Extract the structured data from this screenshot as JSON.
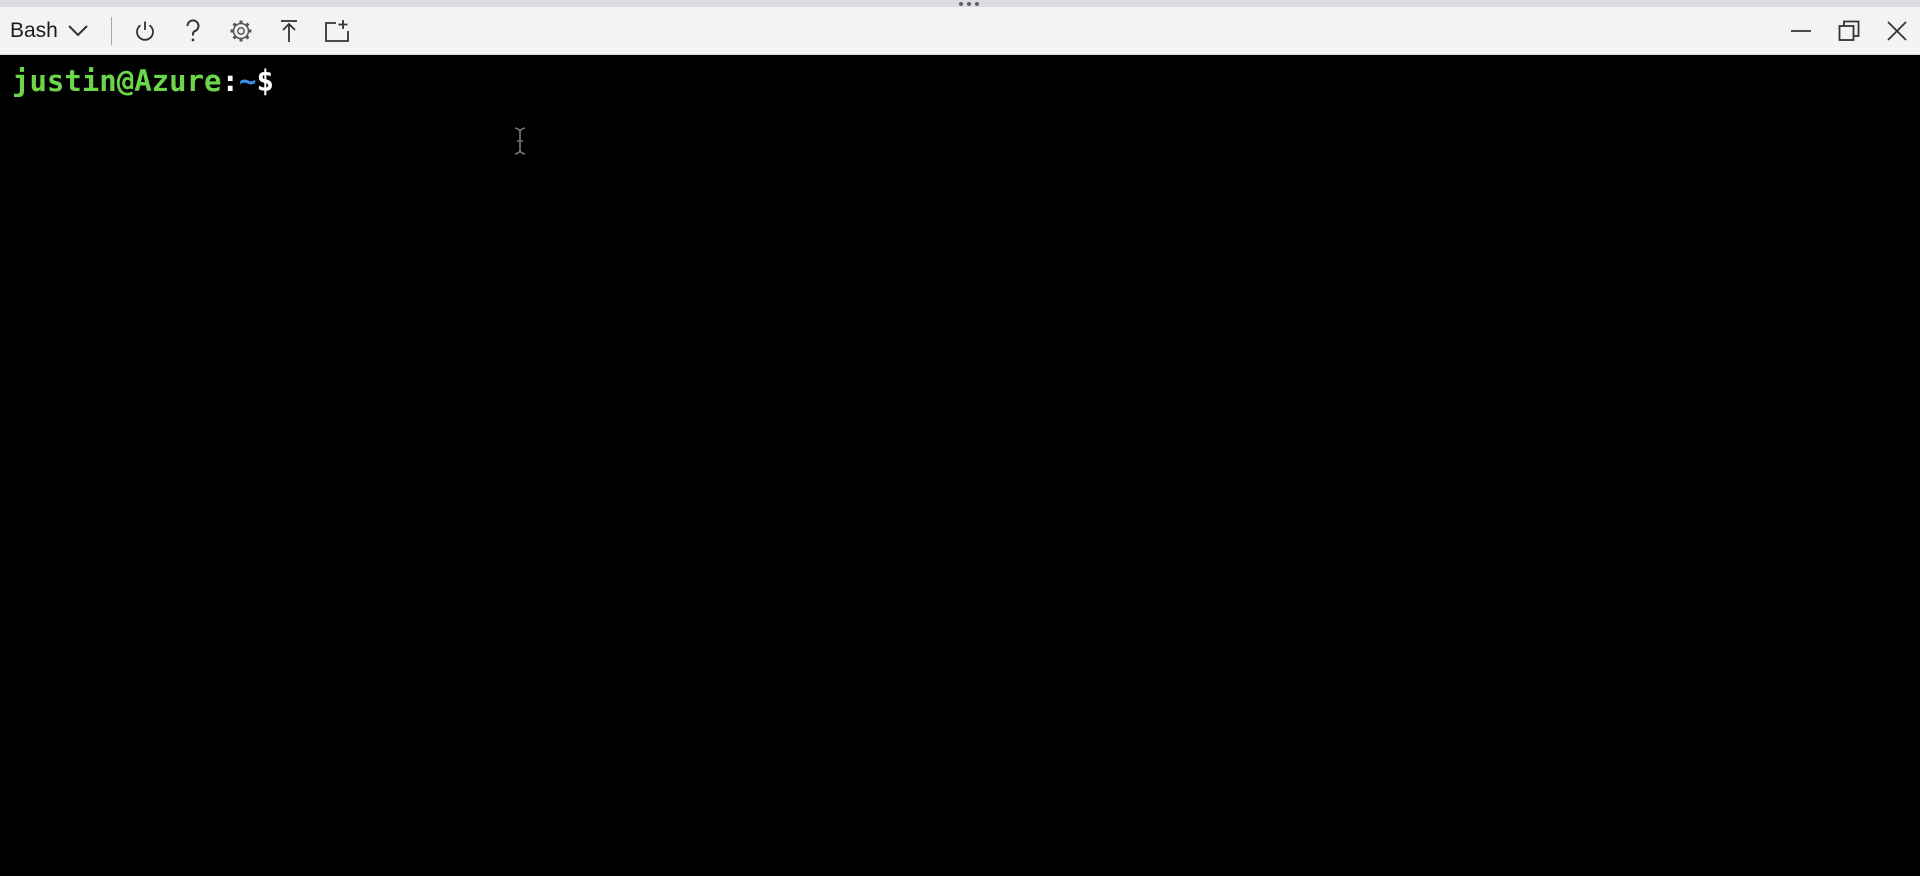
{
  "window": {
    "shell_selector": {
      "value": "Bash",
      "icon": "chevron-down-icon"
    },
    "toolbar_icons": [
      "power-icon",
      "help-icon",
      "gear-icon",
      "upload-icon",
      "open-editor-icon"
    ],
    "window_controls": [
      "minimize-icon",
      "restore-icon",
      "close-icon"
    ]
  },
  "terminal": {
    "prompt": {
      "user_host": "justin@Azure",
      "separator": ":",
      "path": "~",
      "symbol": "$"
    }
  },
  "colors": {
    "toolbar_bg": "#f3f3f3",
    "terminal_bg": "#000000",
    "prompt_user": "#6cd64b",
    "prompt_path": "#3b8eea"
  }
}
